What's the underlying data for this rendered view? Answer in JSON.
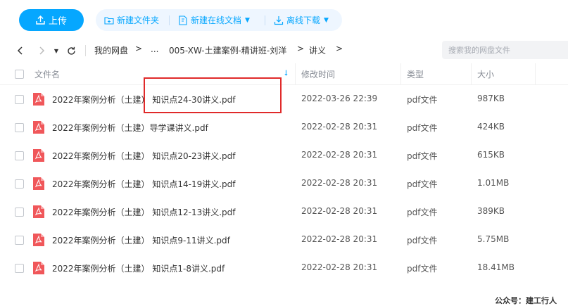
{
  "toolbar": {
    "upload_label": "上传",
    "new_folder_label": "新建文件夹",
    "new_online_doc_label": "新建在线文档",
    "offline_download_label": "离线下载",
    "accent_color": "#06a7ff"
  },
  "nav": {
    "back_icon": "chevron-left-icon",
    "forward_icon": "chevron-right-icon",
    "refresh_icon": "refresh-icon",
    "breadcrumbs": [
      "我的网盘",
      "...",
      "005-XW-土建案例-精讲班-刘洋",
      "讲义"
    ],
    "separator": ">",
    "search_placeholder": "搜索我的网盘文件"
  },
  "table": {
    "columns": {
      "name": "文件名",
      "modified": "修改时间",
      "type": "类型",
      "size": "大小"
    },
    "rows": [
      {
        "name": "2022年案例分析（土建） 知识点24-30讲义.pdf",
        "modified": "2022-03-26 22:39",
        "type": "pdf文件",
        "size": "987KB"
      },
      {
        "name": "2022年案例分析（土建）导学课讲义.pdf",
        "modified": "2022-02-28 20:31",
        "type": "pdf文件",
        "size": "424KB"
      },
      {
        "name": "2022年案例分析（土建） 知识点20-23讲义.pdf",
        "modified": "2022-02-28 20:31",
        "type": "pdf文件",
        "size": "615KB"
      },
      {
        "name": "2022年案例分析（土建） 知识点14-19讲义.pdf",
        "modified": "2022-02-28 20:31",
        "type": "pdf文件",
        "size": "1.01MB"
      },
      {
        "name": "2022年案例分析（土建） 知识点12-13讲义.pdf",
        "modified": "2022-02-28 20:31",
        "type": "pdf文件",
        "size": "389KB"
      },
      {
        "name": "2022年案例分析（土建） 知识点9-11讲义.pdf",
        "modified": "2022-02-28 20:31",
        "type": "pdf文件",
        "size": "5.75MB"
      },
      {
        "name": "2022年案例分析（土建） 知识点1-8讲义.pdf",
        "modified": "2022-02-28 20:31",
        "type": "pdf文件",
        "size": "18.41MB"
      }
    ]
  },
  "watermark": "公众号：建工行人"
}
